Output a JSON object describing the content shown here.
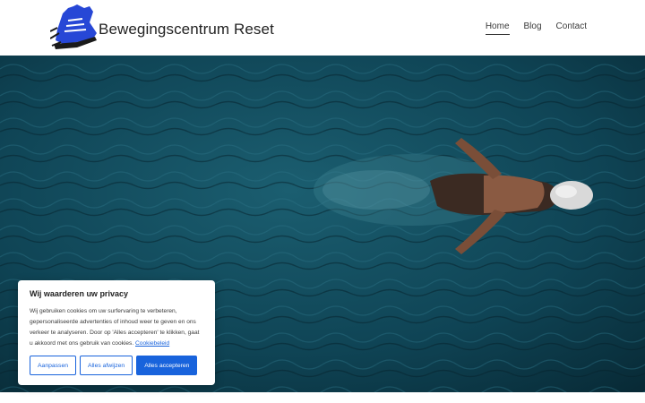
{
  "header": {
    "site_title": "Bewegingscentrum Reset",
    "nav": [
      {
        "label": "Home",
        "active": true
      },
      {
        "label": "Blog",
        "active": false
      },
      {
        "label": "Contact",
        "active": false
      }
    ]
  },
  "hero": {
    "image": "swimmer-in-pool"
  },
  "cookie_banner": {
    "title": "Wij waarderen uw privacy",
    "text": "Wij gebruiken cookies om uw surfervaring te verbeteren, gepersonaliseerde advertenties of inhoud weer te geven en ons verkeer te analyseren. Door op 'Alles accepteren' te klikken, gaat u akkoord met ons gebruik van cookies.",
    "link_label": "Cookiebeleid",
    "buttons": {
      "customize": "Aanpassen",
      "reject": "Alles afwijzen",
      "accept": "Alles accepteren"
    }
  },
  "colors": {
    "accent": "#1863dc",
    "logo_blue": "#2747d6",
    "water": "#0c3644"
  }
}
